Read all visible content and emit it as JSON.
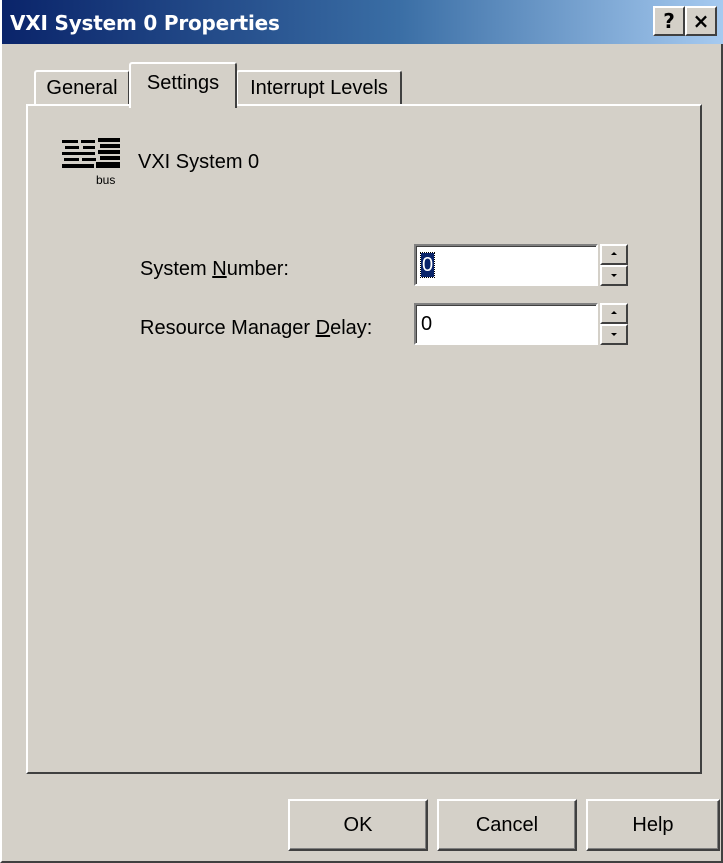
{
  "window": {
    "title": "VXI System 0 Properties",
    "help_button": "?",
    "close_button": "×"
  },
  "tabs": [
    {
      "label": "General",
      "active": false
    },
    {
      "label": "Settings",
      "active": true
    },
    {
      "label": "Interrupt Levels",
      "active": false
    }
  ],
  "device": {
    "icon": "vxi-bus-logo-icon",
    "logo_caption": "bus",
    "name": "VXI System 0"
  },
  "fields": {
    "system_number": {
      "label_before": "System ",
      "label_accel": "N",
      "label_after": "umber:",
      "value": "0",
      "selected": true
    },
    "resource_manager_delay": {
      "label_before": "Resource Manager ",
      "label_accel": "D",
      "label_after": "elay:",
      "value": "0",
      "selected": false
    }
  },
  "buttons": {
    "ok": "OK",
    "cancel": "Cancel",
    "help": "Help"
  },
  "colors": {
    "titlebar_start": "#0a246a",
    "titlebar_end": "#a6caf0",
    "dialog_face": "#d4d0c8",
    "selection": "#0a246a"
  }
}
